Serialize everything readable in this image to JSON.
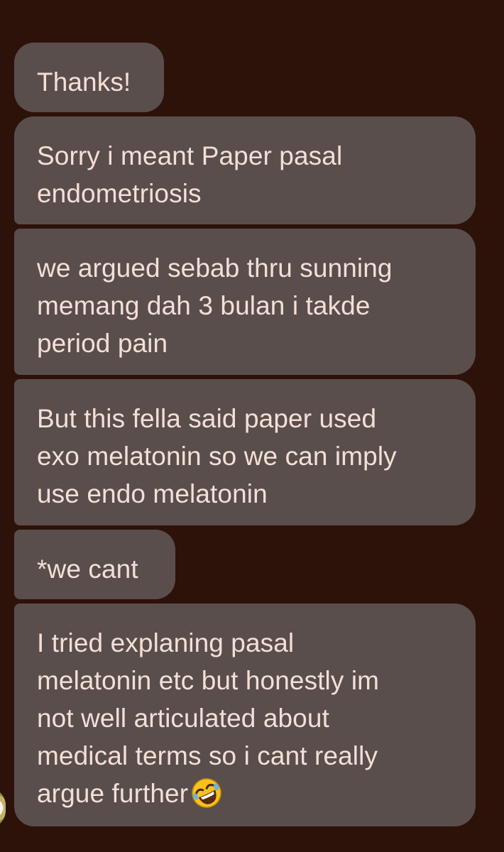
{
  "messages": [
    {
      "text": "Thanks!"
    },
    {
      "text": "Sorry i meant Paper pasal\nendometriosis"
    },
    {
      "text": "we argued sebab thru sunning\nmemang dah 3 bulan i takde\nperiod pain"
    },
    {
      "text": "But this fella said paper used\nexo melatonin so we can imply\nuse endo melatonin"
    },
    {
      "text": "*we cant"
    },
    {
      "text": "I tried explaning pasal\nmelatonin etc but honestly im\nnot well articulated about\nmedical terms so i cant really\nargue further",
      "trailing_icon": "rolling-on-floor-laughing-emoji"
    }
  ],
  "colors": {
    "background": "#2d1209",
    "bubble": "#594e4c",
    "text": "#f4dfd6"
  }
}
